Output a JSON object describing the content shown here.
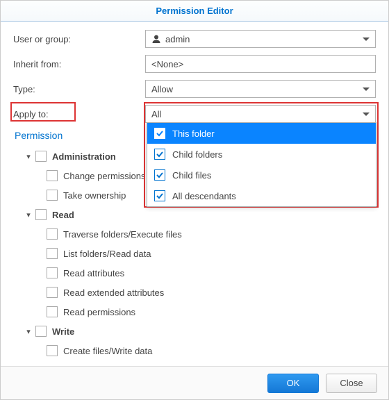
{
  "title": "Permission Editor",
  "form": {
    "user_label": "User or group:",
    "user_value": "admin",
    "inherit_label": "Inherit from:",
    "inherit_value": "<None>",
    "type_label": "Type:",
    "type_value": "Allow",
    "apply_label": "Apply to:",
    "apply_value": "All"
  },
  "dropdown": {
    "items": [
      {
        "label": "This folder",
        "selected": true
      },
      {
        "label": "Child folders",
        "selected": false
      },
      {
        "label": "Child files",
        "selected": false
      },
      {
        "label": "All descendants",
        "selected": false
      }
    ]
  },
  "permissions": {
    "heading": "Permission",
    "groups": [
      {
        "label": "Administration",
        "children": [
          "Change permissions",
          "Take ownership"
        ]
      },
      {
        "label": "Read",
        "children": [
          "Traverse folders/Execute files",
          "List folders/Read data",
          "Read attributes",
          "Read extended attributes",
          "Read permissions"
        ]
      },
      {
        "label": "Write",
        "children": [
          "Create files/Write data"
        ]
      }
    ]
  },
  "buttons": {
    "ok": "OK",
    "close": "Close"
  }
}
